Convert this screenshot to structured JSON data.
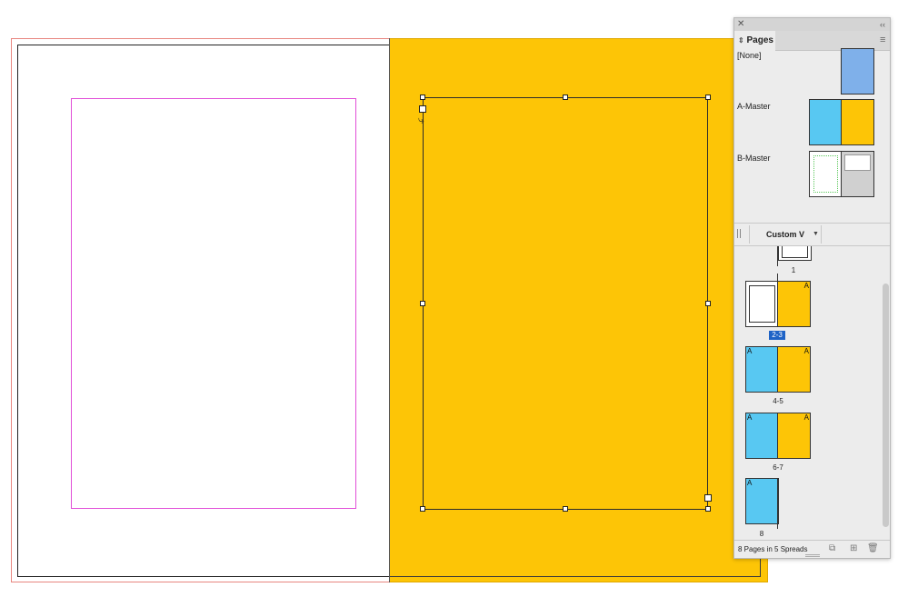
{
  "panel": {
    "tab_label": "Pages",
    "masters": [
      {
        "label": "[None]"
      },
      {
        "label": "A-Master"
      },
      {
        "label": "B-Master"
      }
    ],
    "view_label": "Custom V",
    "spreads": [
      {
        "label": "1"
      },
      {
        "label": "2-3",
        "selected": true
      },
      {
        "label": "4-5"
      },
      {
        "label": "6-7"
      },
      {
        "label": "8"
      }
    ],
    "master_prefix": "A",
    "footer_text": "8 Pages in 5 Spreads"
  },
  "colors": {
    "page_fill": "#fdc506",
    "thumb_blue": "#58c8f2",
    "none_master_blue": "#7fb0ea",
    "margin_guide": "#e14fd8",
    "bleed_guide": "#e8857f",
    "selection_blue": "#1e63c6"
  },
  "icons": {
    "close": "close-icon",
    "collapse": "collapse-icon",
    "panel_menu": "panel-menu-icon",
    "new_page": "new-page-icon",
    "edit_page_size": "edit-page-size-icon",
    "delete": "trash-icon"
  }
}
